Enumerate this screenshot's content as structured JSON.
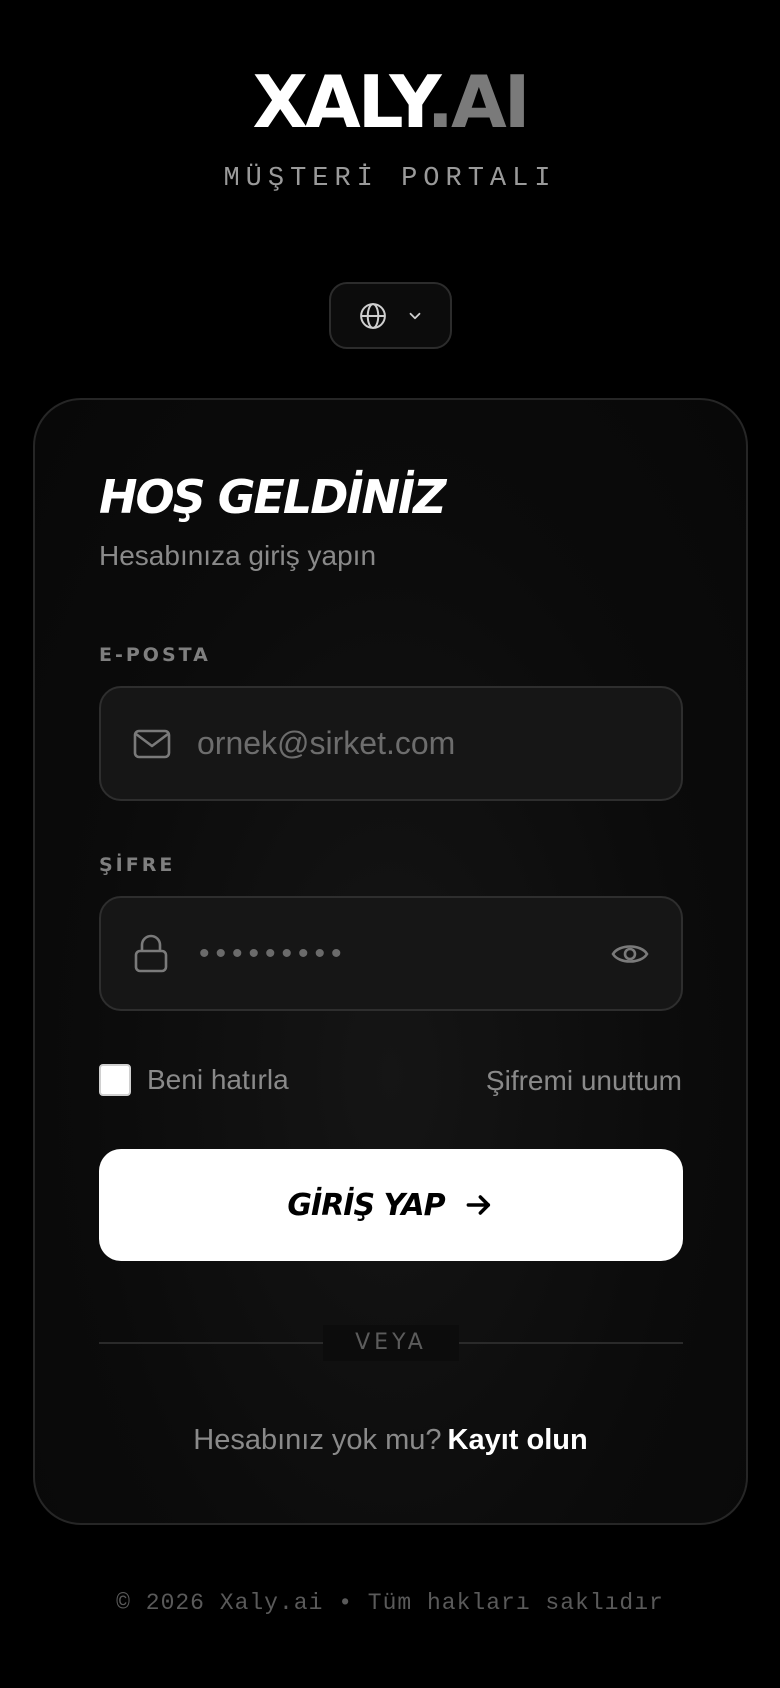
{
  "brand": {
    "name": "XALY",
    "suffix": ".AI",
    "tagline": "MÜŞTERİ PORTALI"
  },
  "language": {
    "icon": "globe-icon",
    "chevron": "chevron-down-icon"
  },
  "login": {
    "title": "HOŞ GELDİNİZ",
    "subtitle": "Hesabınıza giriş yapın",
    "email_label": "E-POSTA",
    "email_placeholder": "ornek@sirket.com",
    "email_value": "",
    "password_label": "ŞİFRE",
    "password_masked": "•••••••••",
    "remember_label": "Beni hatırla",
    "remember_checked": false,
    "forgot_label": "Şifremi unuttum",
    "submit_label": "GİRİŞ YAP",
    "divider_label": "VEYA",
    "signup_prompt": "Hesabınız yok mu?",
    "signup_link": "Kayıt olun"
  },
  "footer": {
    "copyright": "© 2026 Xaly.ai • Tüm hakları saklıdır"
  },
  "colors": {
    "background": "#000000",
    "accent": "#ffffff",
    "muted": "#8a8a8a",
    "brand_suffix": "#7a7a7a"
  }
}
